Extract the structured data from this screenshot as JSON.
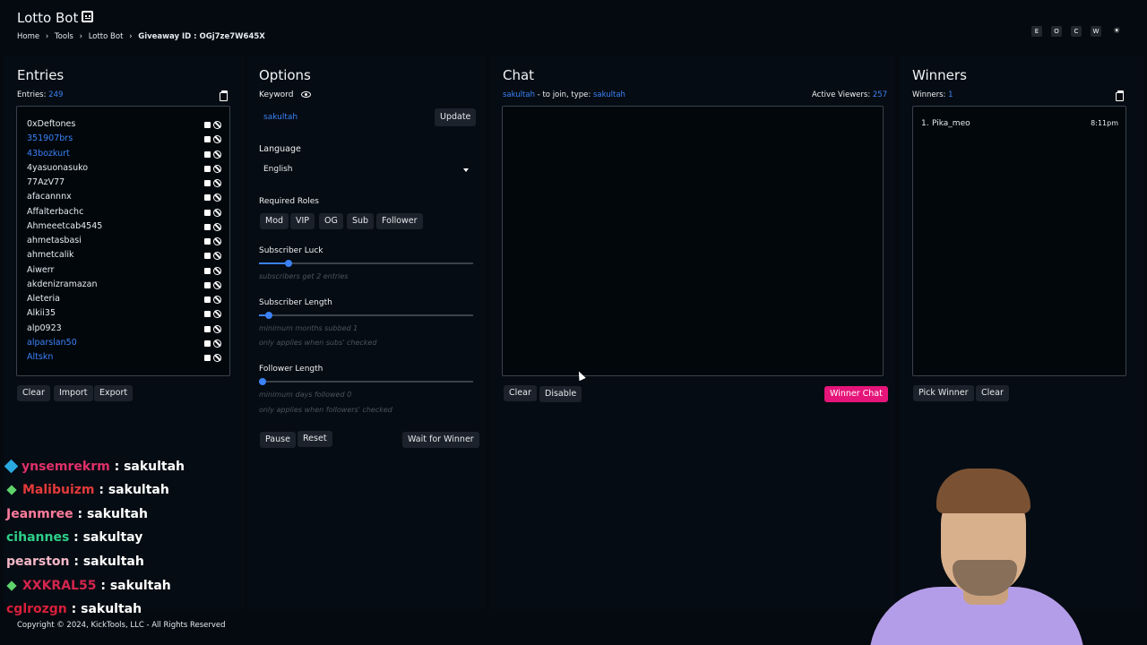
{
  "header": {
    "title": "Lotto Bot",
    "breadcrumb": [
      "Home",
      "Tools",
      "Lotto Bot",
      "Giveaway ID : OGj7ze7W645X"
    ],
    "buttons": [
      "E",
      "O",
      "C",
      "W",
      "☀"
    ]
  },
  "entries": {
    "title": "Entries",
    "count_label": "Entries:",
    "count": "249",
    "list": [
      {
        "name": "0xDeftones",
        "sub": false
      },
      {
        "name": "351907brs",
        "sub": true
      },
      {
        "name": "43bozkurt",
        "sub": true
      },
      {
        "name": "4yasuonasuko",
        "sub": false
      },
      {
        "name": "77AzV77",
        "sub": false
      },
      {
        "name": "afacannnx",
        "sub": false
      },
      {
        "name": "Affalterbachc",
        "sub": false
      },
      {
        "name": "Ahmeeetcab4545",
        "sub": false
      },
      {
        "name": "ahmetasbasi",
        "sub": false
      },
      {
        "name": "ahmetcalik",
        "sub": false
      },
      {
        "name": "Aiwerr",
        "sub": false
      },
      {
        "name": "akdenizramazan",
        "sub": false
      },
      {
        "name": "Aleteria",
        "sub": false
      },
      {
        "name": "Alkii35",
        "sub": false
      },
      {
        "name": "alp0923",
        "sub": false
      },
      {
        "name": "alparslan50",
        "sub": true
      },
      {
        "name": "Altskn",
        "sub": true
      }
    ],
    "buttons": {
      "clear": "Clear",
      "import": "Import",
      "export": "Export"
    }
  },
  "options": {
    "title": "Options",
    "keyword_label": "Keyword",
    "keyword_value": "sakultah",
    "update": "Update",
    "language_label": "Language",
    "language_value": "English",
    "roles_label": "Required Roles",
    "roles": [
      "Mod",
      "VIP",
      "OG",
      "Sub",
      "Follower"
    ],
    "sub_luck_label": "Subscriber Luck",
    "sub_luck_hint": "subscribers get 2 entries",
    "sub_luck_value": 0.12,
    "sub_length_label": "Subscriber Length",
    "sub_length_hint": "minimum months subbed 1",
    "sub_length_hint2": "only applies when subs' checked",
    "sub_length_value": 0.03,
    "fol_length_label": "Follower Length",
    "fol_length_hint": "minimum days followed 0",
    "fol_length_hint2": "only applies when followers' checked",
    "fol_length_value": 0.0,
    "pause": "Pause",
    "reset": "Reset",
    "wait": "Wait for Winner"
  },
  "chat": {
    "title": "Chat",
    "join_user": "sakultah",
    "join_text": " - to join, type: ",
    "join_keyword": "sakultah",
    "viewers_label": "Active Viewers:",
    "viewers": "257",
    "clear": "Clear",
    "disable": "Disable",
    "winner_chat": "Winner Chat",
    "accent": "#e5157a"
  },
  "winners": {
    "title": "Winners",
    "count_label": "Winners:",
    "count": "1",
    "list": [
      {
        "rank": "1.",
        "name": "Pika_meo",
        "time": "8:11pm"
      }
    ],
    "pick": "Pick Winner",
    "clear": "Clear"
  },
  "stream_chat": [
    {
      "badge": "",
      "user": "",
      "user_color": "#ffffff",
      "msg": ""
    },
    {
      "badge": "cube",
      "user": "ynsemrekrm",
      "user_color": "#e0306a",
      "msg": " : sakultah"
    },
    {
      "badge": "diamond",
      "user": "Malibuizm",
      "user_color": "#e23a3a",
      "msg": " : sakultah"
    },
    {
      "badge": "",
      "user": "Jeanmree",
      "user_color": "#ff7b9c",
      "msg": " : sakultah"
    },
    {
      "badge": "",
      "user": "cihannes",
      "user_color": "#2fd08a",
      "msg": " : sakultay"
    },
    {
      "badge": "",
      "user": "pearston",
      "user_color": "#f3b8c8",
      "msg": " : sakultah"
    },
    {
      "badge": "diamond",
      "user": "XXKRAL55",
      "user_color": "#d4254e",
      "msg": " : sakultah"
    },
    {
      "badge": "",
      "user": "cglrozgn",
      "user_color": "#d81f3a",
      "msg": " : sakultah"
    }
  ],
  "footer": "Copyright © 2024, KickTools, LLC - All Rights Reserved"
}
